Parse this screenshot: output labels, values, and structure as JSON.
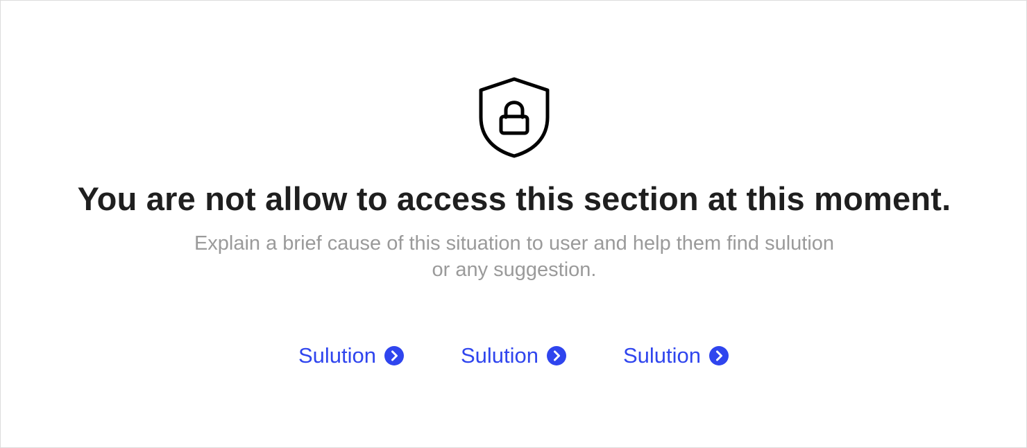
{
  "icon": {
    "name": "shield-lock-icon"
  },
  "message": {
    "title": "You are not allow to access this section at this moment.",
    "description_line1": "Explain a brief cause of this situation to user and help them find sulution",
    "description_line2": "or any suggestion."
  },
  "links": [
    {
      "label": "Sulution",
      "icon": "chevron-right-circle-icon"
    },
    {
      "label": "Sulution",
      "icon": "chevron-right-circle-icon"
    },
    {
      "label": "Sulution",
      "icon": "chevron-right-circle-icon"
    }
  ],
  "colors": {
    "title": "#1f1f1f",
    "description": "#9a9a9a",
    "link": "#2f45ee",
    "border": "#dcdcdc",
    "background": "#ffffff"
  }
}
